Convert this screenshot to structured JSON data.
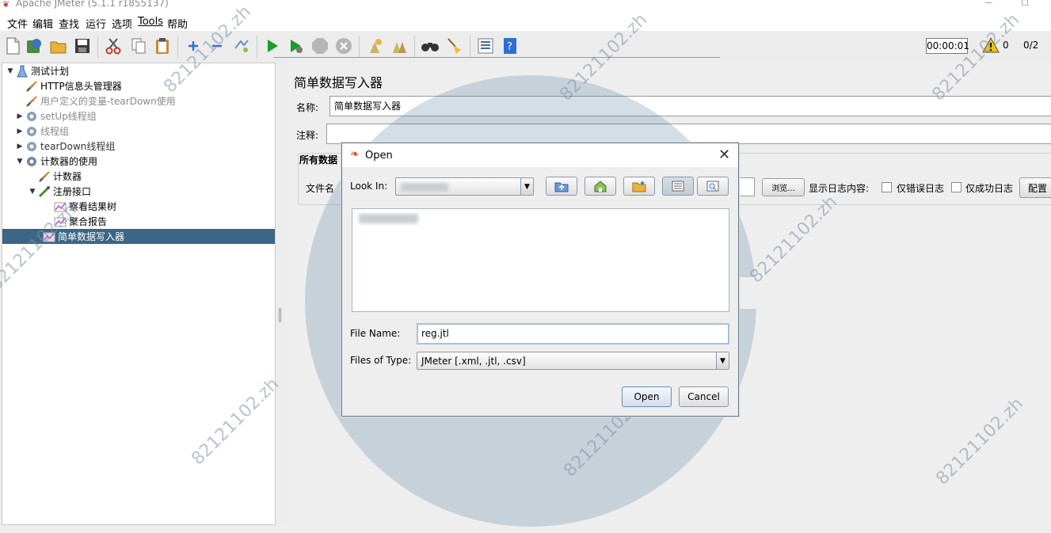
{
  "window": {
    "title": "Apache JMeter (5.1.1 r1855137)"
  },
  "menu": [
    "文件",
    "编辑",
    "查找",
    "运行",
    "选项",
    "Tools",
    "帮助"
  ],
  "toolbar": {
    "timer": "00:00:01",
    "warnings": "0",
    "threads": "0/2"
  },
  "tree": [
    {
      "label": "测试计划",
      "icon": "test-plan-icon"
    },
    {
      "label": "HTTP信息头管理器",
      "icon": "wrench-icon"
    },
    {
      "label": "用户定义的变量-tearDown使用",
      "icon": "wrench-icon"
    },
    {
      "label": "setUp线程组",
      "icon": "gear-icon"
    },
    {
      "label": "线程组",
      "icon": "gear-icon"
    },
    {
      "label": "tearDown线程组",
      "icon": "gear-icon"
    },
    {
      "label": "计数器的使用",
      "icon": "gear-icon"
    },
    {
      "label": "计数器",
      "icon": "wrench-icon"
    },
    {
      "label": "注册接口",
      "icon": "pipette-icon"
    },
    {
      "label": "察看结果树",
      "icon": "listener-icon"
    },
    {
      "label": "聚合报告",
      "icon": "listener-icon"
    },
    {
      "label": "简单数据写入器",
      "icon": "listener-icon"
    }
  ],
  "panel": {
    "title": "简单数据写入器",
    "name_label": "名称:",
    "name_value": "简单数据写入器",
    "comment_label": "注释:",
    "comment_value": "",
    "section_title": "所有数据",
    "filename_label": "文件名",
    "browse_label": "浏览...",
    "log_label": "显示日志内容:",
    "errors_only": "仅错误日志",
    "success_only": "仅成功日志",
    "configure": "配置"
  },
  "dialog": {
    "title": "Open",
    "look_in_label": "Look In:",
    "file_name_label": "File Name:",
    "file_name_value": "reg.jtl",
    "files_of_type_label": "Files of Type:",
    "files_of_type_value": "JMeter [.xml, .jtl, .csv]",
    "open_button": "Open",
    "cancel_button": "Cancel"
  },
  "watermark": "82121102.zh"
}
